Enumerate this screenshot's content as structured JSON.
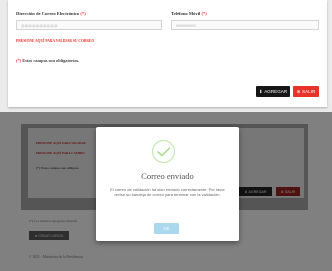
{
  "form": {
    "email_label": "Dirección de Correo Electrónico",
    "email_required": "(*)",
    "email_value": "@@@@@@@@@@",
    "phone_label": "Teléfono Móvil",
    "phone_required": "(*)",
    "phone_value": "9999999999",
    "validate_link": "PRESIONE AQUÍ PARA VALIDAR SU CORREO",
    "required_mark": "(*)",
    "required_note": "Estos campos son obligatorios.",
    "add_button": "AGREGAR",
    "exit_button": "SALIR"
  },
  "background": {
    "validate_link_1": "PRESIONE AQUÍ PARA VALIDAR",
    "validate_link_2": "PRESIONE AQUÍ PARA CAMBIO",
    "required_note": "(*) Estos campos son obligato",
    "add_button": "AGREGAR",
    "exit_button": "SALIR",
    "users_note": "(*) Los usuarios agregados deberán",
    "create_account_button": "CREAR CUENTA",
    "footer": "© 2021 - Ministerio de la Presidencia"
  },
  "modal": {
    "title": "Correo enviado",
    "message": "El correo de validación ha sido enviado correctamente. Por favor revise su bandeja de correo para terminar con la validación.",
    "ok_button": "OK",
    "check_color": "#a5dc86"
  },
  "colors": {
    "danger": "#e8332a",
    "dark_button": "#161616"
  }
}
